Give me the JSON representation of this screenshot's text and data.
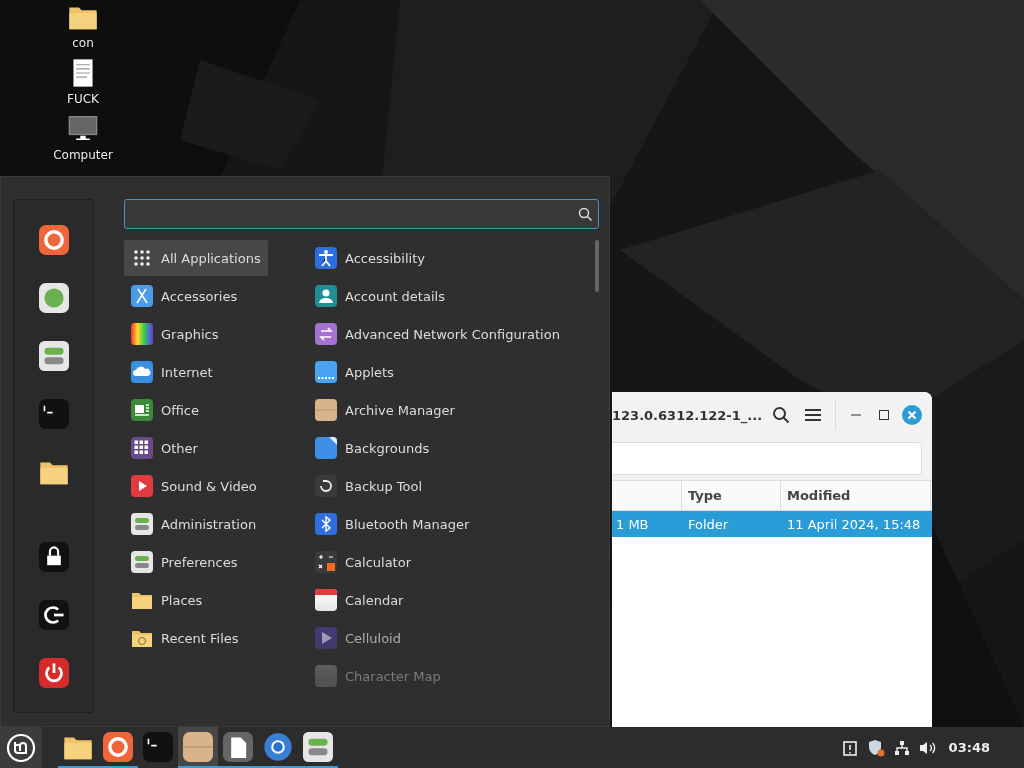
{
  "desktop": {
    "icons": [
      {
        "label": "con"
      },
      {
        "label": "FUCK"
      },
      {
        "label": "Computer"
      }
    ]
  },
  "menu": {
    "search": {
      "focused": true
    },
    "categories": [
      {
        "label": "All Applications",
        "selected": true
      },
      {
        "label": "Accessories",
        "selected": false
      },
      {
        "label": "Graphics",
        "selected": false
      },
      {
        "label": "Internet",
        "selected": false
      },
      {
        "label": "Office",
        "selected": false
      },
      {
        "label": "Other",
        "selected": false
      },
      {
        "label": "Sound & Video",
        "selected": false
      },
      {
        "label": "Administration",
        "selected": false
      },
      {
        "label": "Preferences",
        "selected": false
      },
      {
        "label": "Places",
        "selected": false
      },
      {
        "label": "Recent Files",
        "selected": false
      }
    ],
    "apps": [
      {
        "label": "Accessibility"
      },
      {
        "label": "Account details"
      },
      {
        "label": "Advanced Network Configuration"
      },
      {
        "label": "Applets"
      },
      {
        "label": "Archive Manager"
      },
      {
        "label": "Backgrounds"
      },
      {
        "label": "Backup Tool"
      },
      {
        "label": "Bluetooth Manager"
      },
      {
        "label": "Calculator"
      },
      {
        "label": "Calendar"
      },
      {
        "label": "Celluloid"
      },
      {
        "label": "Character Map"
      }
    ]
  },
  "file_window": {
    "title": "123.0.6312.122-1_...",
    "columns": [
      "",
      "Type",
      "Modified"
    ],
    "rows": [
      {
        "cells": [
          "1 MB",
          "Folder",
          "11 April 2024, 15:48"
        ],
        "selected": true
      }
    ]
  },
  "taskbar": {
    "launchers": [
      {
        "running": true,
        "selected": false
      },
      {
        "running": true,
        "selected": false
      },
      {
        "running": false,
        "selected": false
      },
      {
        "running": true,
        "selected": true
      },
      {
        "running": true,
        "selected": false
      },
      {
        "running": true,
        "selected": false
      },
      {
        "running": true,
        "selected": false
      }
    ],
    "clock": "03:48"
  }
}
